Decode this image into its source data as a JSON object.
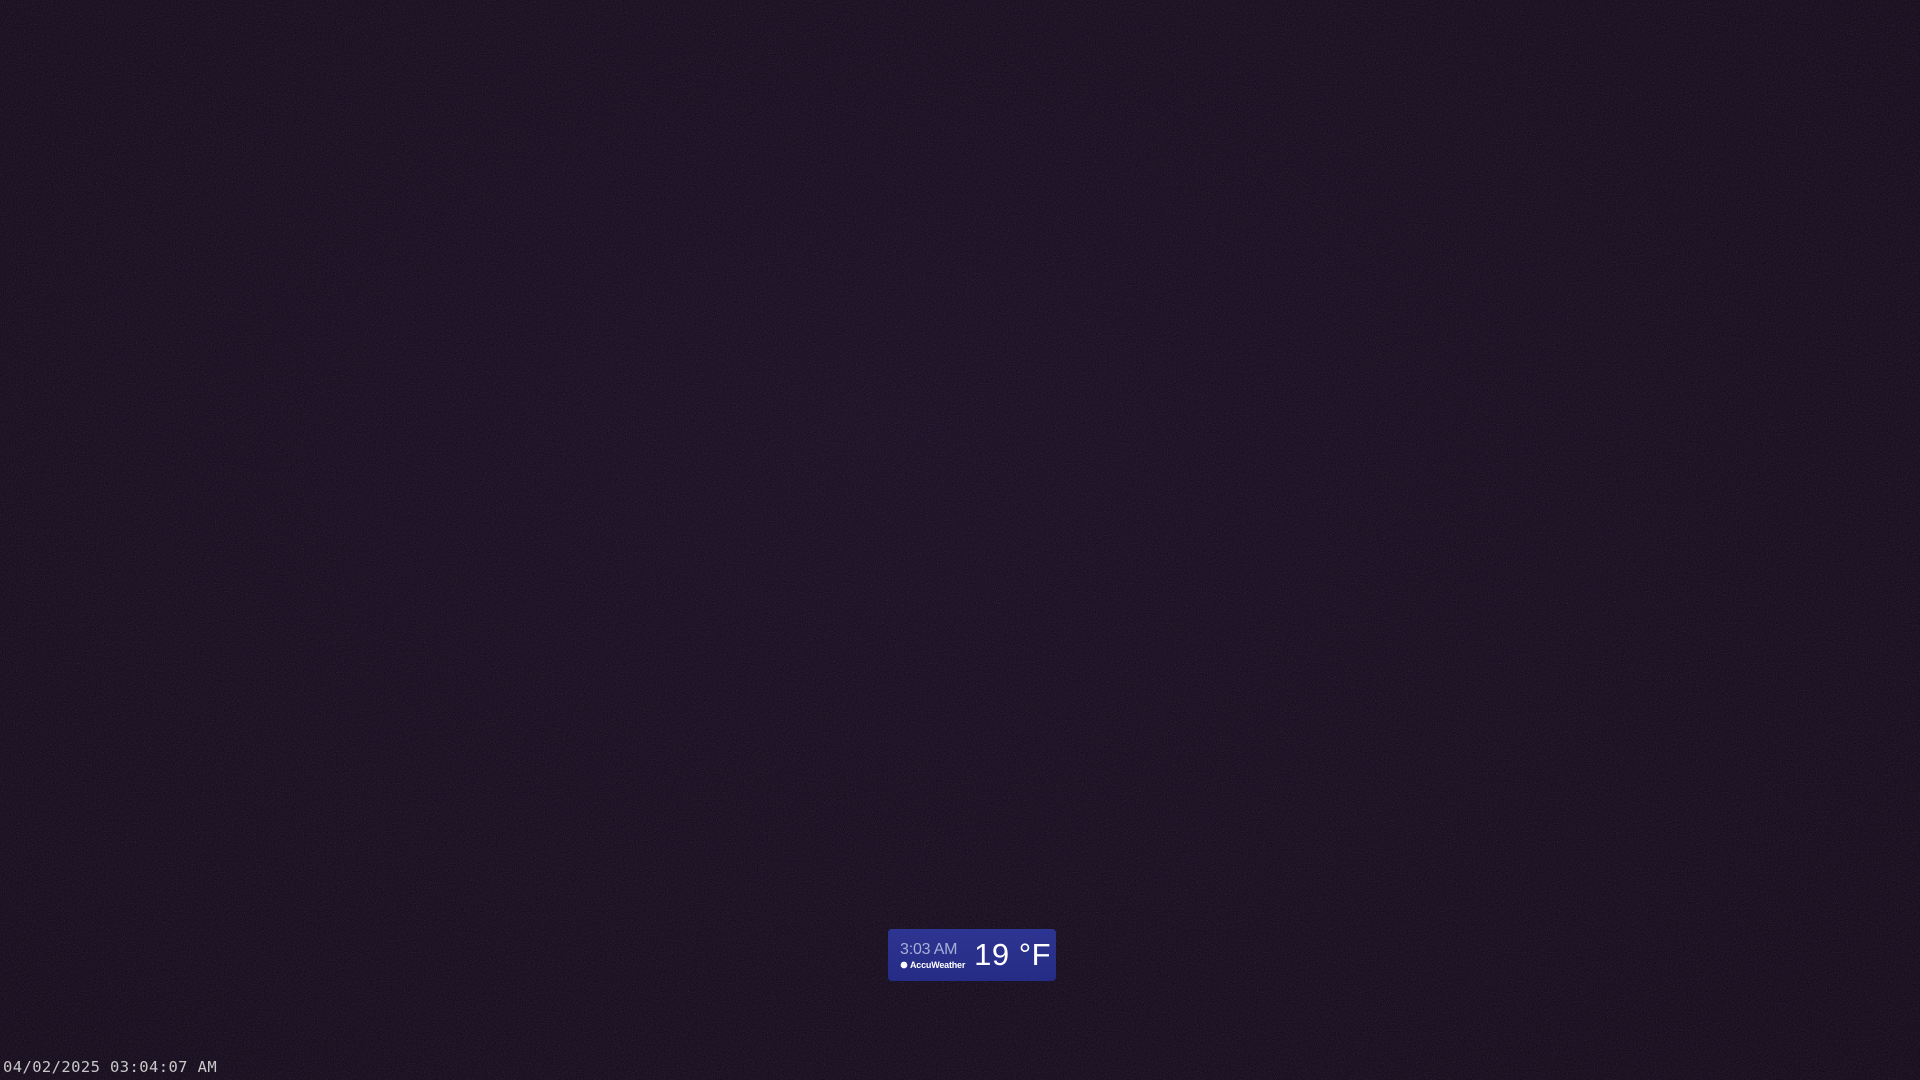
{
  "overlay": {
    "timestamp": "04/02/2025 03:04:07 AM"
  },
  "weather_badge": {
    "time": "3:03 AM",
    "brand": "AccuWeather",
    "brand_icon": "sun-icon",
    "temperature": "19 °F",
    "background_color": "#2a3189"
  },
  "colors": {
    "feed_background": "#0a070f",
    "timestamp_text": "#c9c9c9"
  }
}
